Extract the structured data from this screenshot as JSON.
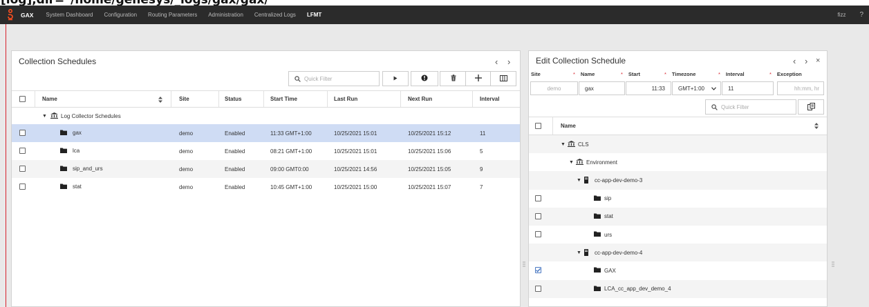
{
  "path_text": "[log],dir=\"/home/genesys/_logs/gax/gax/",
  "nav": {
    "brand": "GAX",
    "items": [
      "System Dashboard",
      "Configuration",
      "Routing Parameters",
      "Administration",
      "Centralized Logs",
      "LFMT"
    ],
    "active_index": 5,
    "user": "fizz",
    "help": "?"
  },
  "schedules": {
    "title": "Collection Schedules",
    "quick_filter_placeholder": "Quick Filter",
    "columns": [
      "Name",
      "Site",
      "Status",
      "Start Time",
      "Last Run",
      "Next Run",
      "Interval"
    ],
    "group_label": "Log Collector Schedules",
    "rows": [
      {
        "name": "gax",
        "site": "demo",
        "status": "Enabled",
        "start": "11:33 GMT+1:00",
        "last": "10/25/2021 15:01",
        "next": "10/25/2021 15:12",
        "interval": "11",
        "selected": true
      },
      {
        "name": "lca",
        "site": "demo",
        "status": "Enabled",
        "start": "08:21 GMT+1:00",
        "last": "10/25/2021 15:01",
        "next": "10/25/2021 15:06",
        "interval": "5",
        "selected": false
      },
      {
        "name": "sip_and_urs",
        "site": "demo",
        "status": "Enabled",
        "start": "09:00 GMT0:00",
        "last": "10/25/2021 14:56",
        "next": "10/25/2021 15:05",
        "interval": "9",
        "selected": false
      },
      {
        "name": "stat",
        "site": "demo",
        "status": "Enabled",
        "start": "10:45 GMT+1:00",
        "last": "10/25/2021 15:00",
        "next": "10/25/2021 15:07",
        "interval": "7",
        "selected": false
      }
    ]
  },
  "edit": {
    "title": "Edit Collection Schedule",
    "labels": {
      "site": "Site",
      "name": "Name",
      "start": "Start",
      "timezone": "Timezone",
      "interval": "Interval",
      "exception": "Exception"
    },
    "values": {
      "site": "demo",
      "name": "gax",
      "start": "11:33",
      "timezone": "GMT+1:00",
      "interval": "11"
    },
    "exception_placeholder": "hh:mm, hr",
    "quick_filter_placeholder": "Quick Filter",
    "tree_header": "Name",
    "tree": [
      {
        "label": "CLS",
        "kind": "bank",
        "depth": 1,
        "checkbox": false,
        "checked": false
      },
      {
        "label": "Environment",
        "kind": "bank",
        "depth": 2,
        "checkbox": false,
        "checked": false
      },
      {
        "label": "cc-app-dev-demo-3",
        "kind": "server",
        "depth": 3,
        "checkbox": false,
        "checked": false
      },
      {
        "label": "sip",
        "kind": "folder",
        "depth": 4,
        "checkbox": true,
        "checked": false
      },
      {
        "label": "stat",
        "kind": "folder",
        "depth": 4,
        "checkbox": true,
        "checked": false
      },
      {
        "label": "urs",
        "kind": "folder",
        "depth": 4,
        "checkbox": true,
        "checked": false
      },
      {
        "label": "cc-app-dev-demo-4",
        "kind": "server",
        "depth": 3,
        "checkbox": false,
        "checked": false
      },
      {
        "label": "GAX",
        "kind": "folder",
        "depth": 4,
        "checkbox": true,
        "checked": true
      },
      {
        "label": "LCA_cc_app_dev_demo_4",
        "kind": "folder",
        "depth": 4,
        "checkbox": true,
        "checked": false
      }
    ]
  },
  "colors": {
    "accent": "#d8212b",
    "navbar": "#2b2b2b",
    "selected_row": "#cfdcf4",
    "check": "#4a78c2"
  }
}
